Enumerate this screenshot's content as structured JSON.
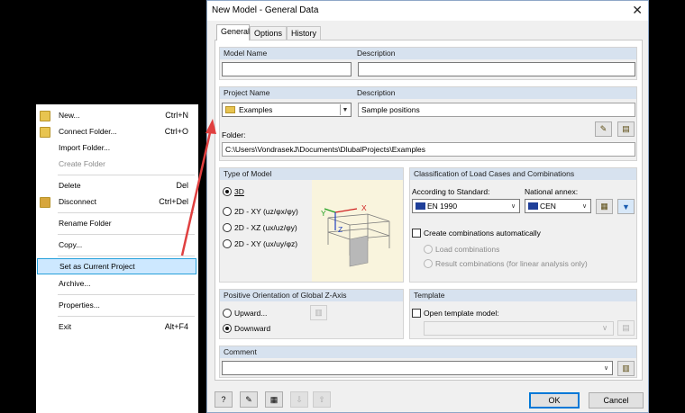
{
  "context_menu": {
    "items": [
      {
        "label": "New...",
        "shortcut": "Ctrl+N",
        "icon": "new-folder-icon"
      },
      {
        "label": "Connect Folder...",
        "shortcut": "Ctrl+O",
        "icon": "connect-folder-icon"
      },
      {
        "label": "Import Folder...",
        "shortcut": ""
      },
      {
        "label": "Create Folder",
        "shortcut": ""
      },
      {
        "label": "Delete",
        "shortcut": "Del"
      },
      {
        "label": "Disconnect",
        "shortcut": "Ctrl+Del",
        "icon": "disconnect-icon"
      },
      {
        "label": "Rename Folder",
        "shortcut": ""
      },
      {
        "label": "Copy...",
        "shortcut": ""
      },
      {
        "label": "Set as Current Project",
        "shortcut": ""
      },
      {
        "label": "Archive...",
        "shortcut": ""
      },
      {
        "label": "Properties...",
        "shortcut": ""
      },
      {
        "label": "Exit",
        "shortcut": "Alt+F4"
      }
    ]
  },
  "dialog": {
    "title": "New Model - General Data",
    "close_icon": "close-icon",
    "tabs": [
      "General",
      "Options",
      "History"
    ],
    "model_name_label": "Model Name",
    "description_label": "Description",
    "model_name_value": "",
    "description_value": "",
    "project_name_label": "Project Name",
    "project_description_label": "Description",
    "project_name_value": "Examples",
    "project_description_value": "Sample positions",
    "folder_label": "Folder:",
    "folder_value": "C:\\Users\\VondrasekJ\\Documents\\DlubalProjects\\Examples",
    "type_of_model": {
      "header": "Type of Model",
      "options": [
        "3D",
        "2D - XY (uz/φx/φy)",
        "2D - XZ (ux/uz/φy)",
        "2D - XY (ux/uy/φz)"
      ],
      "selected": "3D"
    },
    "classification": {
      "header": "Classification of Load Cases and Combinations",
      "standard_label": "According to Standard:",
      "annex_label": "National annex:",
      "standard_value": "EN 1990",
      "annex_value": "CEN",
      "create_auto_label": "Create combinations automatically",
      "load_combinations_label": "Load combinations",
      "result_combinations_label": "Result combinations (for linear analysis only)"
    },
    "z_axis": {
      "header": "Positive Orientation of Global Z-Axis",
      "upward": "Upward...",
      "downward": "Downward",
      "selected": "Downward"
    },
    "template": {
      "header": "Template",
      "open_label": "Open template model:",
      "value": ""
    },
    "comment": {
      "label": "Comment",
      "value": ""
    },
    "ok_label": "OK",
    "cancel_label": "Cancel",
    "preview_axes": {
      "x": "X",
      "y": "Y",
      "z": "Z"
    }
  },
  "colors": {
    "group_header": "#d7e2ef",
    "highlight": "#cde8ff",
    "arrow": "#e04040"
  }
}
